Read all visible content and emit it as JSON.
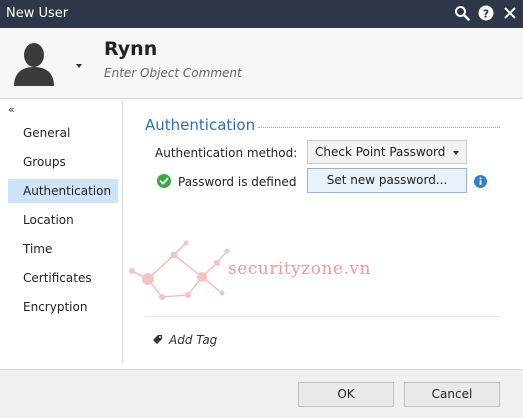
{
  "window": {
    "title": "New User"
  },
  "titlebar": {
    "icons": [
      "search-icon",
      "help-icon",
      "close-icon"
    ]
  },
  "header": {
    "name": "Rynn",
    "comment": "Enter Object Comment",
    "avatar_icon": "user-silhouette-icon"
  },
  "nav": {
    "collapse": "«",
    "items": [
      {
        "label": "General"
      },
      {
        "label": "Groups"
      },
      {
        "label": "Authentication"
      },
      {
        "label": "Location"
      },
      {
        "label": "Time"
      },
      {
        "label": "Certificates"
      },
      {
        "label": "Encryption"
      }
    ],
    "active": "Authentication"
  },
  "authentication": {
    "title": "Authentication",
    "method_label": "Authentication method:",
    "method_value": "Check Point Password",
    "status_text": "Password is defined",
    "set_password_button": "Set new password..."
  },
  "watermark": {
    "text": "securityzone.vn"
  },
  "tags": {
    "add_label": "Add Tag"
  },
  "footer": {
    "ok": "OK",
    "cancel": "Cancel"
  },
  "colors": {
    "titlebar": "#2d3748",
    "accent": "#2f6fb0",
    "active_nav": "#cfe3f6",
    "check_green": "#3aa845",
    "watermark": "#ef9a9a"
  }
}
